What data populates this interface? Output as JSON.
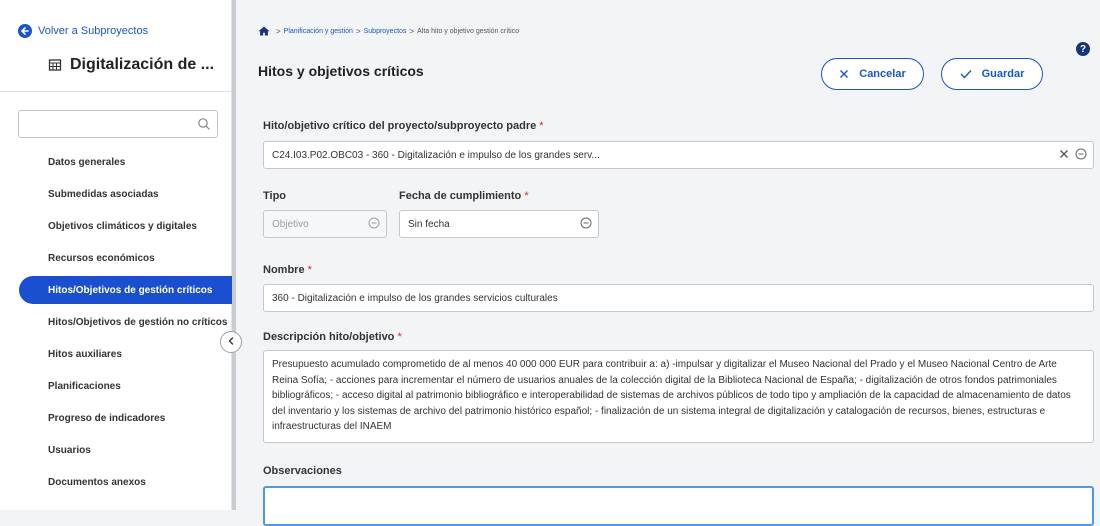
{
  "sidebar": {
    "back_label": "Volver a Subproyectos",
    "project_title": "Digitalización de ...",
    "search_placeholder": "",
    "items": [
      {
        "label": "Datos generales"
      },
      {
        "label": "Submedidas asociadas"
      },
      {
        "label": "Objetivos climáticos y digitales"
      },
      {
        "label": "Recursos económicos"
      },
      {
        "label": "Hitos/Objetivos de gestión críticos",
        "active": true
      },
      {
        "label": "Hitos/Objetivos de gestión no críticos"
      },
      {
        "label": "Hitos auxiliares"
      },
      {
        "label": "Planificaciones"
      },
      {
        "label": "Progreso de indicadores"
      },
      {
        "label": "Usuarios"
      },
      {
        "label": "Documentos anexos"
      }
    ]
  },
  "breadcrumb": {
    "items": [
      "Planificación y gestión",
      "Subproyectos"
    ],
    "separator": ">",
    "current": "Alta hito y objetivo gestión crítico"
  },
  "header": {
    "title": "Hitos y objetivos críticos",
    "cancel_label": "Cancelar",
    "save_label": "Guardar",
    "help": "?"
  },
  "form": {
    "parent": {
      "label": "Hito/objetivo crítico del proyecto/subproyecto padre",
      "value": "C24.I03.P02.OBC03 - 360 - Digitalización e impulso de los grandes serv..."
    },
    "tipo": {
      "label": "Tipo",
      "value": "Objetivo"
    },
    "fecha": {
      "label": "Fecha de cumplimiento",
      "value": "Sin fecha"
    },
    "nombre": {
      "label": "Nombre",
      "value": "360 - Digitalización e impulso de los grandes servicios culturales"
    },
    "descripcion": {
      "label": "Descripción hito/objetivo",
      "value": "Presupuesto acumulado comprometido de al menos 40 000 000 EUR para contribuir a: a) -impulsar y digitalizar el Museo Nacional del Prado y el Museo Nacional Centro de Arte Reina Sofía; - acciones para incrementar el número de usuarios anuales de la colección digital de la Biblioteca Nacional de España; - digitalización de otros fondos patrimoniales bibliográficos; - acceso digital al patrimonio bibliográfico e interoperabilidad de sistemas de archivos públicos de todo tipo y ampliación de la capacidad de almacenamiento de datos del inventario y los sistemas de archivo del patrimonio histórico español; - finalización de un sistema integral de digitalización y catalogación de recursos, bienes, estructuras e infraestructuras del INAEM"
    },
    "observaciones": {
      "label": "Observaciones",
      "value": ""
    },
    "required_mark": "*"
  },
  "colors": {
    "accent": "#1a56c4",
    "active_nav": "#1a4fd0",
    "required": "#d9262c",
    "focus": "#4a9ae8"
  },
  "icons": [
    "back-arrow-icon",
    "table-icon",
    "search-icon",
    "home-icon",
    "help-icon",
    "close-icon",
    "check-icon",
    "clear-icon",
    "collapse-icon",
    "chevron-left-icon"
  ]
}
